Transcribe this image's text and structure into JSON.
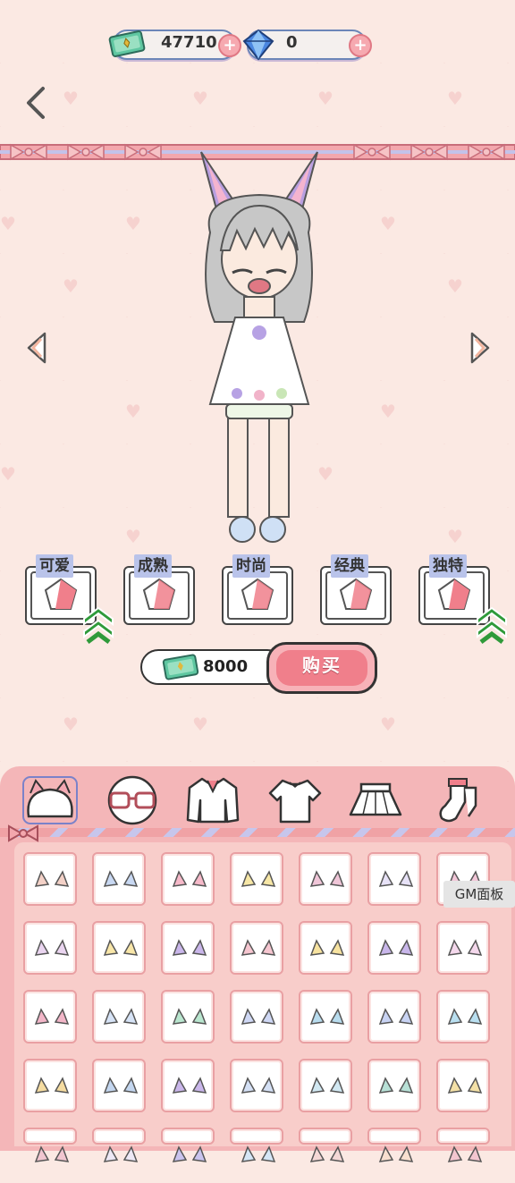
{
  "currency": {
    "cash_value": "47710",
    "gem_value": "0",
    "cash_icon": "cash-bill-icon",
    "gem_icon": "diamond-icon",
    "add_icon": "plus-icon"
  },
  "nav": {
    "back_icon": "chevron-left-icon",
    "prev_icon": "triangle-left-icon",
    "next_icon": "triangle-right-icon"
  },
  "styles": [
    {
      "label": "可爱",
      "boosted": true
    },
    {
      "label": "成熟",
      "boosted": false
    },
    {
      "label": "时尚",
      "boosted": false
    },
    {
      "label": "经典",
      "boosted": false
    },
    {
      "label": "独特",
      "boosted": true
    }
  ],
  "purchase": {
    "price": "8000",
    "buy_label": "购买"
  },
  "categories": [
    "ears",
    "glasses",
    "jacket",
    "top",
    "skirt",
    "socks"
  ],
  "selected_category": "ears",
  "gm_panel_label": "GM面板",
  "colors": {
    "accent": "#f07f8b",
    "panel": "#f4b6b8",
    "background": "#fbe9e3",
    "badge": "#b9c3ea",
    "boost": "#2f9a3a"
  }
}
